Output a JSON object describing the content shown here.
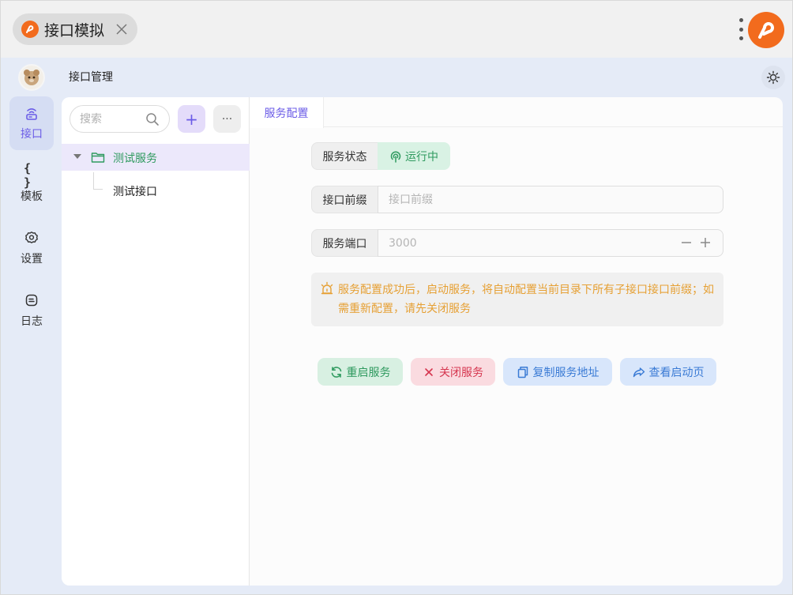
{
  "app": {
    "tab_title": "接口模拟"
  },
  "header": {
    "title": "接口管理"
  },
  "sidebar": {
    "items": [
      {
        "label": "接口",
        "icon": "router-icon",
        "active": true
      },
      {
        "label": "模板",
        "icon": "braces-icon",
        "active": false
      },
      {
        "label": "设置",
        "icon": "gear-icon",
        "active": false
      },
      {
        "label": "日志",
        "icon": "log-icon",
        "active": false
      }
    ]
  },
  "tree": {
    "search_placeholder": "搜索",
    "add_label": "+",
    "more_label": "···",
    "nodes": [
      {
        "label": "测试服务",
        "type": "folder",
        "expanded": true,
        "selected": true
      },
      {
        "label": "测试接口",
        "type": "leaf",
        "selected": false
      }
    ]
  },
  "detail": {
    "tabs": [
      {
        "label": "服务配置",
        "active": true
      }
    ],
    "status": {
      "label": "服务状态",
      "value": "运行中"
    },
    "prefix": {
      "label": "接口前缀",
      "placeholder": "接口前缀",
      "value": ""
    },
    "port": {
      "label": "服务端口",
      "placeholder": "3000",
      "value": ""
    },
    "notice": "服务配置成功后，启动服务，将自动配置当前目录下所有子接口接口前缀；如需重新配置，请先关闭服务",
    "actions": {
      "restart": "重启服务",
      "stop": "关闭服务",
      "copy": "复制服务地址",
      "view": "查看启动页"
    }
  },
  "colors": {
    "accent": "#6b5ce7",
    "success": "#2f9a5f",
    "danger": "#d6364f",
    "info": "#3a7bd5",
    "warning": "#e6a034",
    "brand": "#f26b1d"
  }
}
